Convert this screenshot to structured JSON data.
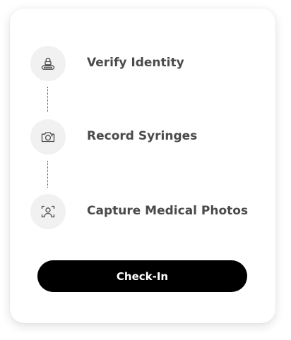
{
  "steps": [
    {
      "label": "Verify Identity",
      "icon": "lock-keypad-icon"
    },
    {
      "label": "Record Syringes",
      "icon": "camera-icon"
    },
    {
      "label": "Capture Medical Photos",
      "icon": "face-scan-icon"
    }
  ],
  "action": {
    "label": "Check-In"
  },
  "colors": {
    "button_bg": "#000000",
    "button_text": "#ffffff",
    "icon_circle": "#f1f1f1",
    "label_text": "#4a4a4a"
  }
}
